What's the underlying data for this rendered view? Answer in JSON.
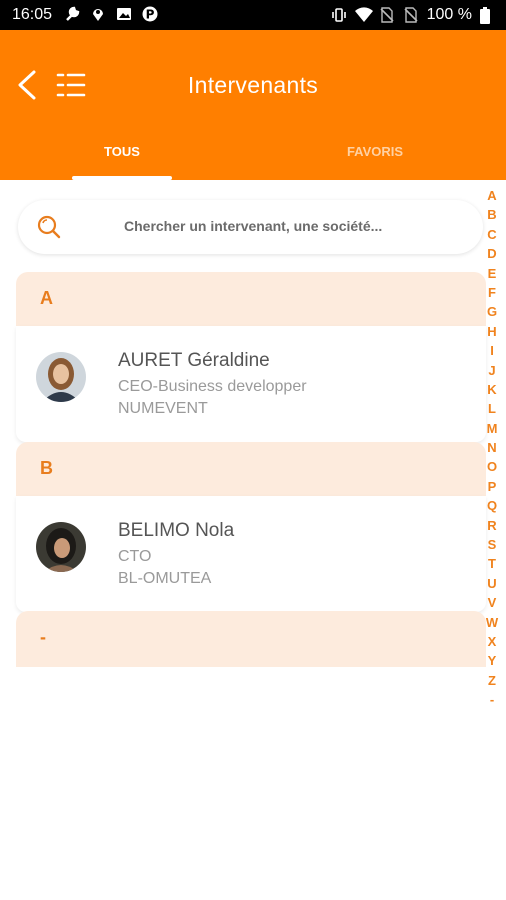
{
  "status_bar": {
    "time": "16:05",
    "battery_text": "100 %",
    "left_icons": [
      "wrench-icon",
      "location-icon",
      "image-icon",
      "parking-icon"
    ],
    "right_icons": [
      "vibrate-icon",
      "wifi-icon",
      "no-sim-icon",
      "no-sim-icon",
      "battery-icon"
    ]
  },
  "header": {
    "title": "Intervenants",
    "tabs": [
      {
        "label": "TOUS",
        "active": true
      },
      {
        "label": "FAVORIS",
        "active": false
      }
    ],
    "accent_color": "#ff7f00"
  },
  "search": {
    "placeholder": "Chercher un intervenant, une société..."
  },
  "sections": [
    {
      "letter": "A",
      "people": [
        {
          "name": "AURET Géraldine",
          "role": "CEO-Business developper",
          "company": "NUMEVENT"
        }
      ]
    },
    {
      "letter": "B",
      "people": [
        {
          "name": "BELIMO Nola",
          "role": "CTO",
          "company": "BL-OMUTEA"
        }
      ]
    },
    {
      "letter": "-",
      "people": []
    }
  ],
  "alphabet_index": [
    "A",
    "B",
    "C",
    "D",
    "E",
    "F",
    "G",
    "H",
    "I",
    "J",
    "K",
    "L",
    "M",
    "N",
    "O",
    "P",
    "Q",
    "R",
    "S",
    "T",
    "U",
    "V",
    "W",
    "X",
    "Y",
    "Z",
    "-"
  ]
}
